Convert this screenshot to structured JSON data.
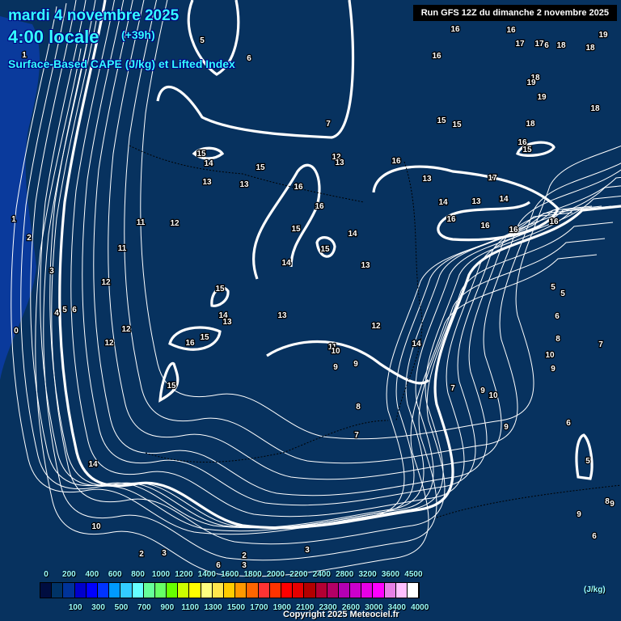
{
  "header": {
    "date": "mardi 4 novembre 2025",
    "time": "4:00 locale",
    "lead": "(+39h)",
    "parameter": "Surface-Based CAPE (J/kg) et Lifted Index",
    "run": "Run GFS 12Z du dimanche 2 novembre 2025"
  },
  "colors": {
    "background": "#07325f",
    "ocean_cape": "#0a3a9c",
    "contour": "#ffffff",
    "title": "#33ffff"
  },
  "legend": {
    "unit": "(J/kg)",
    "top_labels": [
      "0",
      "200",
      "400",
      "600",
      "800",
      "1000",
      "1200",
      "1400",
      "1600",
      "1800",
      "2000",
      "2200",
      "2400",
      "2800",
      "3200",
      "3600",
      "4500"
    ],
    "bottom_labels": [
      "100",
      "300",
      "500",
      "700",
      "900",
      "1100",
      "1300",
      "1500",
      "1700",
      "1900",
      "2100",
      "2300",
      "2600",
      "3000",
      "3400",
      "4000"
    ],
    "swatches": [
      "#000d40",
      "#003366",
      "#003399",
      "#0000cc",
      "#0000ff",
      "#0033ff",
      "#0099ff",
      "#33ccff",
      "#66ffff",
      "#66ff99",
      "#66ff66",
      "#66ff00",
      "#ccff00",
      "#ffff00",
      "#ffff80",
      "#ffe64d",
      "#ffcc00",
      "#ff9900",
      "#ff6600",
      "#ff3333",
      "#ff3300",
      "#ff0000",
      "#e60000",
      "#b30000",
      "#b30033",
      "#b30066",
      "#b300b3",
      "#cc00cc",
      "#e600e6",
      "#ff00ff",
      "#e680e6",
      "#ffc0ff",
      "#ffffff"
    ]
  },
  "lifted_index_labels": [
    "1",
    "5",
    "6",
    "7",
    "16",
    "16",
    "17",
    "17",
    "6",
    "18",
    "19",
    "18",
    "16",
    "18",
    "19",
    "19",
    "18",
    "15",
    "15",
    "18",
    "16",
    "15",
    "15",
    "14",
    "15",
    "12",
    "13",
    "16",
    "13",
    "17",
    "13",
    "13",
    "16",
    "16",
    "14",
    "13",
    "14",
    "16",
    "16",
    "16",
    "16",
    "1",
    "2",
    "11",
    "12",
    "11",
    "15",
    "14",
    "15",
    "14",
    "13",
    "3",
    "12",
    "15",
    "5",
    "5",
    "4",
    "5",
    "6",
    "14",
    "13",
    "13",
    "6",
    "0",
    "12",
    "12",
    "15",
    "16",
    "12",
    "14",
    "8",
    "7",
    "11",
    "10",
    "10",
    "9",
    "9",
    "9",
    "15",
    "9",
    "10",
    "7",
    "8",
    "9",
    "6",
    "7",
    "5",
    "14",
    "9",
    "8",
    "9",
    "10",
    "6",
    "2",
    "3",
    "3",
    "2",
    "6",
    "3"
  ],
  "copyright": "Copyright 2025 Meteociel.fr"
}
